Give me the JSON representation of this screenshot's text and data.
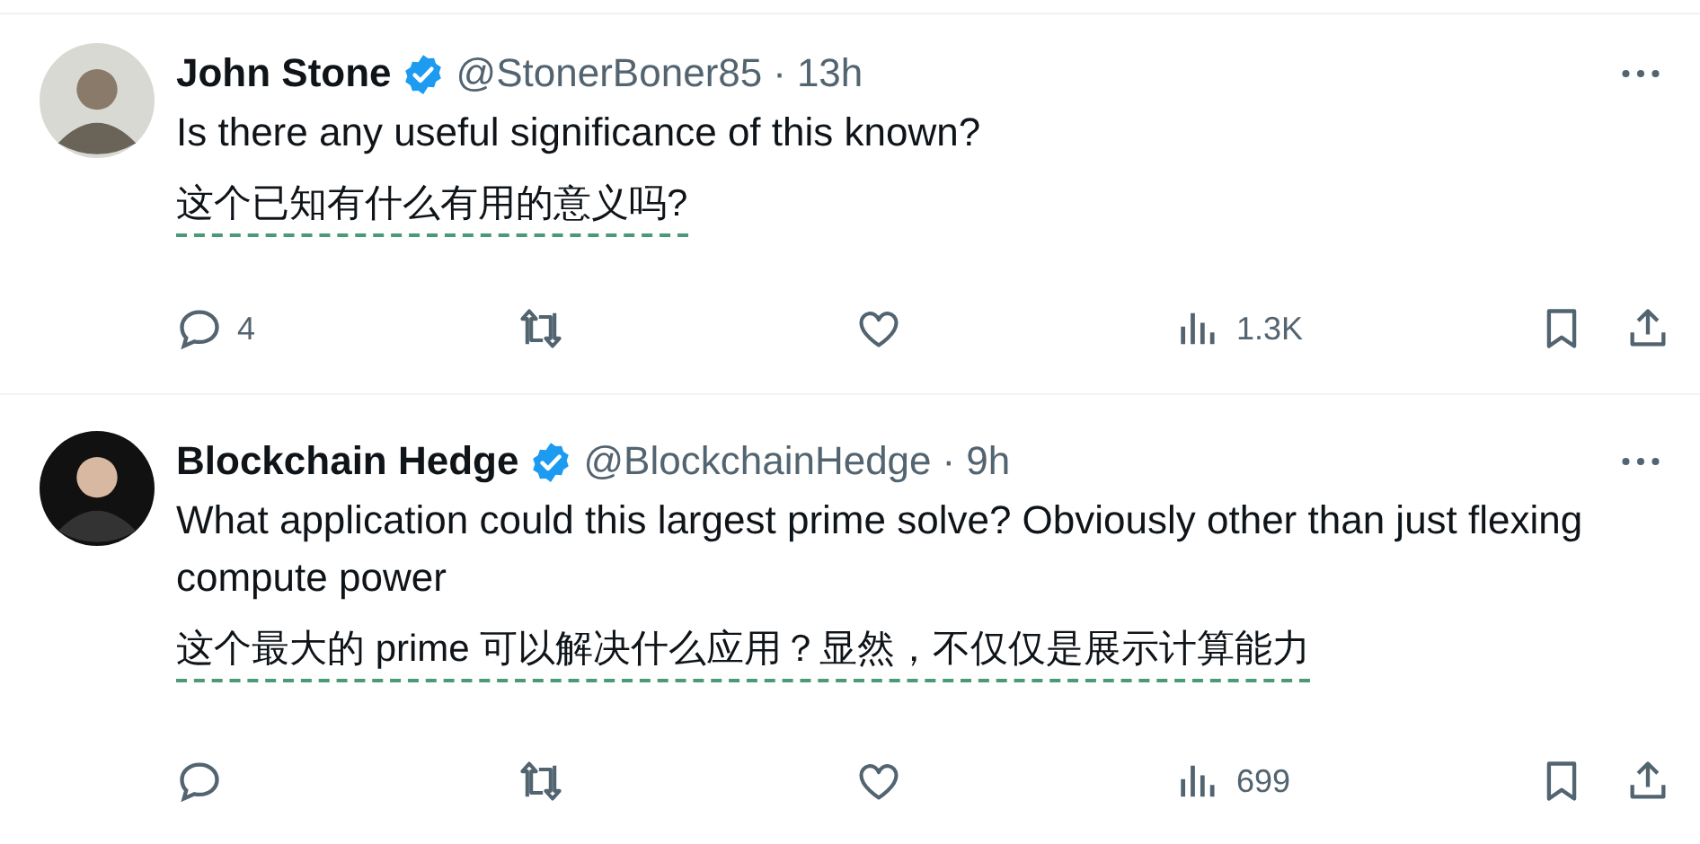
{
  "tweets": [
    {
      "name": "John Stone",
      "verified": true,
      "handle": "@StonerBoner85",
      "separator": "·",
      "time": "13h",
      "text": "Is there any useful significance of this known?",
      "translation": "这个已知有什么有用的意义吗?",
      "replies": "4",
      "views": "1.3K"
    },
    {
      "name": "Blockchain Hedge",
      "verified": true,
      "handle": "@BlockchainHedge",
      "separator": "·",
      "time": "9h",
      "text": "What application could this largest prime solve? Obviously other than just flexing compute power",
      "translation": "这个最大的 prime 可以解决什么应用？显然，不仅仅是展示计算能力",
      "views": "699"
    }
  ]
}
